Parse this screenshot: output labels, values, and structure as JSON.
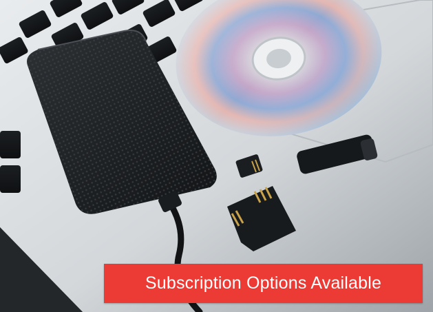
{
  "cta": {
    "label": "Subscription Options Available",
    "color": "#ec3a35"
  },
  "photo": {
    "subject": "external-hard-drive-cd-usb-sd-cards-on-laptop"
  }
}
